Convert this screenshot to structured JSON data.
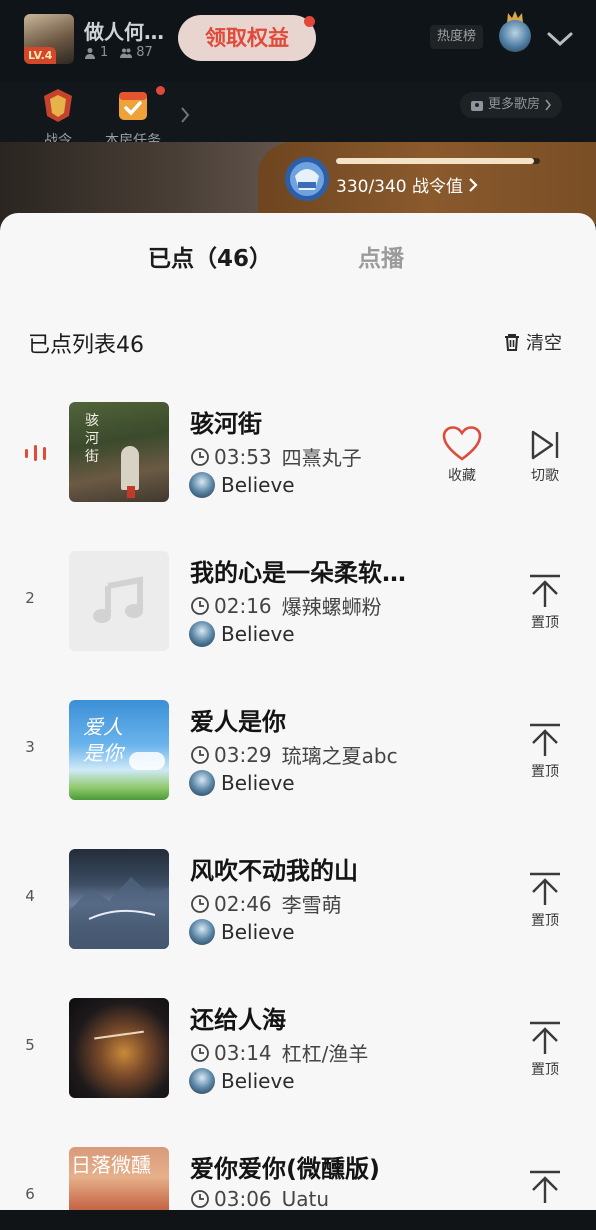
{
  "room": {
    "name": "做人何…",
    "level": "LV.4",
    "members": "1",
    "fans": "87",
    "claim_label": "领取权益",
    "hot_rank_label": "热度榜"
  },
  "nav": {
    "items": [
      {
        "label": "战令"
      },
      {
        "label": "本房任务"
      }
    ],
    "more_rooms": "更多歌房"
  },
  "battle_pass": {
    "text": "330/340 战令值",
    "progress": 0.97
  },
  "tabs": {
    "active": "已点（46）",
    "inactive": "点播"
  },
  "list": {
    "title": "已点列表46",
    "clear": "清空"
  },
  "songs": [
    {
      "index": "",
      "title": "骇河街",
      "duration": "03:53",
      "artist": "四熹丸子",
      "requester": "Believe",
      "actions": [
        "收藏",
        "切歌"
      ]
    },
    {
      "index": "2",
      "title": "我的心是一朵柔软…",
      "duration": "02:16",
      "artist": "爆辣螺蛳粉",
      "requester": "Believe",
      "actions": [
        "置顶"
      ]
    },
    {
      "index": "3",
      "title": "爱人是你",
      "duration": "03:29",
      "artist": "琉璃之夏abc",
      "requester": "Believe",
      "actions": [
        "置顶"
      ]
    },
    {
      "index": "4",
      "title": "风吹不动我的山",
      "duration": "02:46",
      "artist": "李雪萌",
      "requester": "Believe",
      "actions": [
        "置顶"
      ]
    },
    {
      "index": "5",
      "title": "还给人海",
      "duration": "03:14",
      "artist": "杠杠/渔羊",
      "requester": "Believe",
      "actions": [
        "置顶"
      ]
    },
    {
      "index": "6",
      "title": "爱你爱你(微醺版)",
      "duration": "03:06",
      "artist": "Uatu",
      "requester": "Believe",
      "actions": [
        "置顶"
      ]
    }
  ],
  "covers": {
    "c1_text": "骇河街",
    "c3_text": "爱人是你",
    "c6_text": "日落微醺"
  },
  "colors": {
    "accent_red": "#e04a3a",
    "pass_gold": "#8a5a2d"
  }
}
